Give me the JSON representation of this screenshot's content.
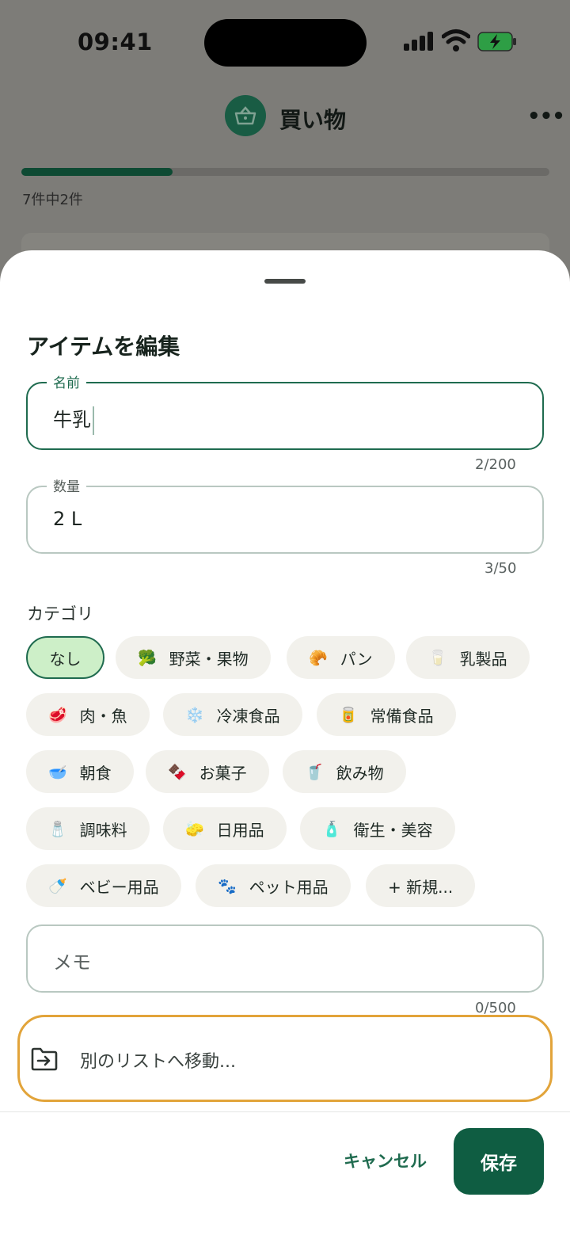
{
  "status_bar": {
    "time": "09:41"
  },
  "app_bar": {
    "title": "買い物",
    "more_label": "•••"
  },
  "progress": {
    "text": "7件中2件",
    "fraction": 0.2857
  },
  "sheet": {
    "title": "アイテムを編集",
    "name_field": {
      "label": "名前",
      "value": "牛乳",
      "counter": "2/200"
    },
    "quantity_field": {
      "label": "数量",
      "value": "2 L",
      "counter": "3/50"
    },
    "category_label": "カテゴリ",
    "categories": [
      {
        "label": "なし",
        "emoji": "",
        "selected": true
      },
      {
        "label": "野菜・果物",
        "emoji": "🥦"
      },
      {
        "label": "パン",
        "emoji": "🥐"
      },
      {
        "label": "乳製品",
        "emoji": "🥛"
      },
      {
        "label": "肉・魚",
        "emoji": "🥩"
      },
      {
        "label": "冷凍食品",
        "emoji": "❄️"
      },
      {
        "label": "常備食品",
        "emoji": "🥫"
      },
      {
        "label": "朝食",
        "emoji": "🥣"
      },
      {
        "label": "お菓子",
        "emoji": "🍫"
      },
      {
        "label": "飲み物",
        "emoji": "🥤"
      },
      {
        "label": "調味料",
        "emoji": "🧂"
      },
      {
        "label": "日用品",
        "emoji": "🧽"
      },
      {
        "label": "衛生・美容",
        "emoji": "🧴"
      },
      {
        "label": "ベビー用品",
        "emoji": "🍼"
      },
      {
        "label": "ペット用品",
        "emoji": "🐾"
      },
      {
        "label": "+ 新規...",
        "emoji": ""
      }
    ],
    "memo_field": {
      "placeholder": "メモ",
      "counter": "0/500"
    },
    "move_action": {
      "label": "別のリストへ移動...",
      "icon": "folder-move-icon"
    },
    "cancel_label": "キャンセル",
    "save_label": "保存"
  },
  "colors": {
    "accent": "#0f5d42",
    "highlight": "#e2a43a",
    "chip_selected": "#cdefc8"
  }
}
